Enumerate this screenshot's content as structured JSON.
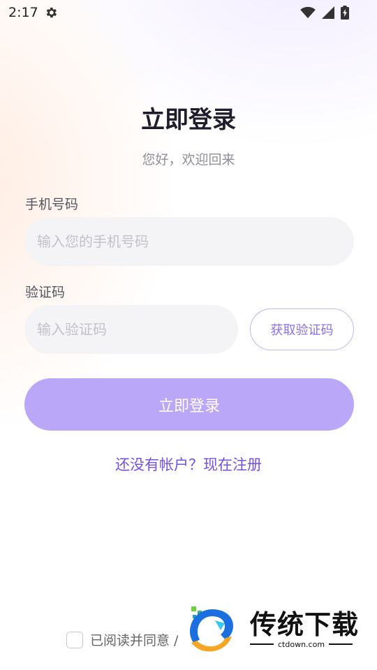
{
  "status_bar": {
    "time": "2:17"
  },
  "header": {
    "title": "立即登录",
    "subtitle": "您好，欢迎回来"
  },
  "form": {
    "phone": {
      "label": "手机号码",
      "placeholder": "输入您的手机号码",
      "value": ""
    },
    "code": {
      "label": "验证码",
      "placeholder": "输入验证码",
      "value": "",
      "button_label": "获取验证码"
    },
    "submit_label": "立即登录"
  },
  "register_link": "还没有帐户？现在注册",
  "agreement": {
    "checked": false,
    "text": "已阅读并同意 /"
  },
  "watermark": {
    "title": "传统下载",
    "url": "ctdown.com"
  },
  "colors": {
    "accent": "#7550e6",
    "button": "#bba7f7",
    "input_bg": "#f4f4f6",
    "title": "#1f1d2b"
  },
  "icons": [
    "settings-gear-icon",
    "wifi-icon",
    "cell-signal-icon",
    "battery-charging-icon",
    "brand-logo-icon"
  ]
}
